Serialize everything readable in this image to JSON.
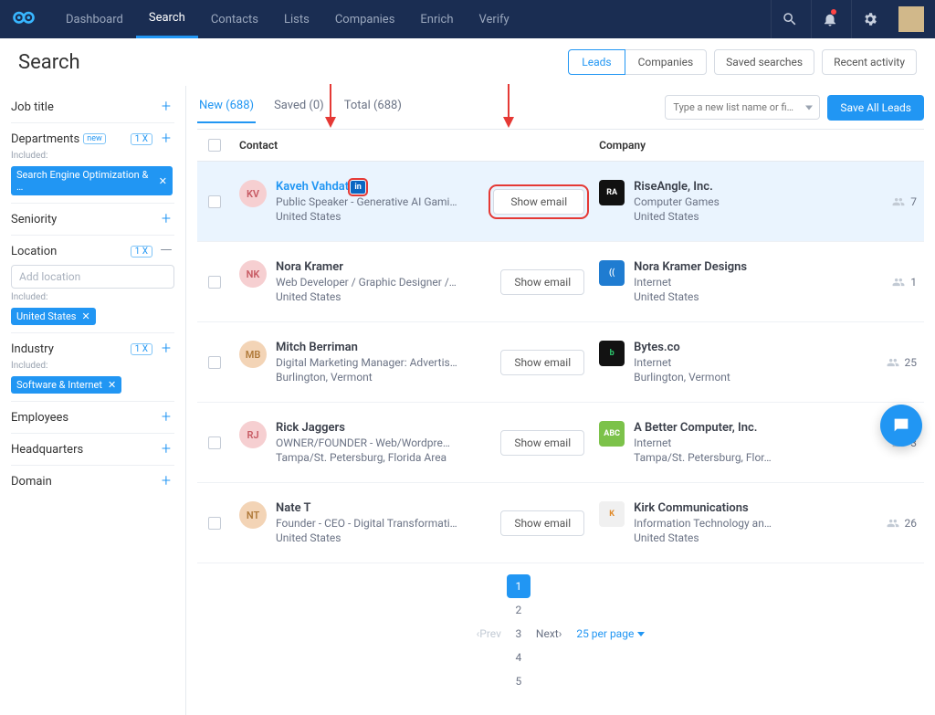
{
  "nav": {
    "items": [
      "Dashboard",
      "Search",
      "Contacts",
      "Lists",
      "Companies",
      "Enrich",
      "Verify"
    ],
    "active_index": 1
  },
  "page": {
    "title": "Search"
  },
  "header_actions": {
    "segmented": [
      "Leads",
      "Companies"
    ],
    "segmented_active": 0,
    "saved_searches": "Saved searches",
    "recent_activity": "Recent activity"
  },
  "filters": {
    "job_title": {
      "label": "Job title"
    },
    "departments": {
      "label": "Departments",
      "badge": "new",
      "count_badge": "1 X",
      "included_label": "Included:",
      "chips": [
        "Search Engine Optimization & …"
      ]
    },
    "seniority": {
      "label": "Seniority"
    },
    "location": {
      "label": "Location",
      "count_badge": "1 X",
      "placeholder": "Add location",
      "included_label": "Included:",
      "chips": [
        "United States"
      ]
    },
    "industry": {
      "label": "Industry",
      "count_badge": "1 X",
      "included_label": "Included:",
      "chips": [
        "Software & Internet"
      ]
    },
    "employees": {
      "label": "Employees"
    },
    "headquarters": {
      "label": "Headquarters"
    },
    "domain": {
      "label": "Domain"
    }
  },
  "tabs": {
    "items": [
      {
        "label": "New (688)"
      },
      {
        "label": "Saved (0)"
      },
      {
        "label": "Total (688)"
      }
    ],
    "active_index": 0
  },
  "toolbar": {
    "list_placeholder": "Type a new list name or fi…",
    "save_all": "Save All Leads"
  },
  "table": {
    "headers": {
      "contact": "Contact",
      "company": "Company"
    },
    "show_email": "Show email",
    "rows": [
      {
        "initials": "KV",
        "av_bg": "#f6cfd1",
        "av_fg": "#c75a63",
        "name": "Kaveh Vahdat",
        "linkedin": true,
        "highlight": true,
        "title": "Public Speaker - Generative AI Gami…",
        "location": "United States",
        "company": {
          "name": "RiseAngle, Inc.",
          "industry": "Computer Games",
          "location": "United States",
          "logo_bg": "#111",
          "logo_txt": "RA",
          "employees": 7
        }
      },
      {
        "initials": "NK",
        "av_bg": "#f6cfd1",
        "av_fg": "#c75a63",
        "name": "Nora Kramer",
        "title": "Web Developer / Graphic Designer /…",
        "location": "United States",
        "company": {
          "name": "Nora Kramer Designs",
          "industry": "Internet",
          "location": "United States",
          "logo_bg": "#1f7cd1",
          "logo_txt": "((",
          "employees": 1
        }
      },
      {
        "initials": "MB",
        "av_bg": "#f3d4b6",
        "av_fg": "#b07a3a",
        "name": "Mitch Berriman",
        "title": "Digital Marketing Manager: Advertis…",
        "location": "Burlington, Vermont",
        "company": {
          "name": "Bytes.co",
          "industry": "Internet",
          "location": "Burlington, Vermont",
          "logo_bg": "#121212",
          "logo_txt": "b",
          "logo_fg": "#2ecc71",
          "employees": 25
        }
      },
      {
        "initials": "RJ",
        "av_bg": "#f6cfd1",
        "av_fg": "#c75a63",
        "name": "Rick Jaggers",
        "title": "OWNER/FOUNDER - Web/Wordpre…",
        "location": "Tampa/St. Petersburg, Florida Area",
        "company": {
          "name": "A Better Computer, Inc.",
          "industry": "Internet",
          "location": "Tampa/St. Petersburg, Flor…",
          "logo_bg": "#7cc24a",
          "logo_txt": "ABC",
          "employees": 3
        }
      },
      {
        "initials": "NT",
        "av_bg": "#f3d4b6",
        "av_fg": "#b07a3a",
        "name": "Nate T",
        "title": "Founder - CEO - Digital Transformati…",
        "location": "United States",
        "company": {
          "name": "Kirk Communications",
          "industry": "Information Technology an…",
          "location": "United States",
          "logo_bg": "#f0f0f0",
          "logo_txt": "K",
          "logo_fg": "#e08a2a",
          "employees": 26
        }
      }
    ]
  },
  "pagination": {
    "prev": "Prev",
    "pages": [
      "1",
      "2",
      "3",
      "4",
      "5"
    ],
    "active_index": 0,
    "next": "Next",
    "per_page": "25 per page"
  }
}
